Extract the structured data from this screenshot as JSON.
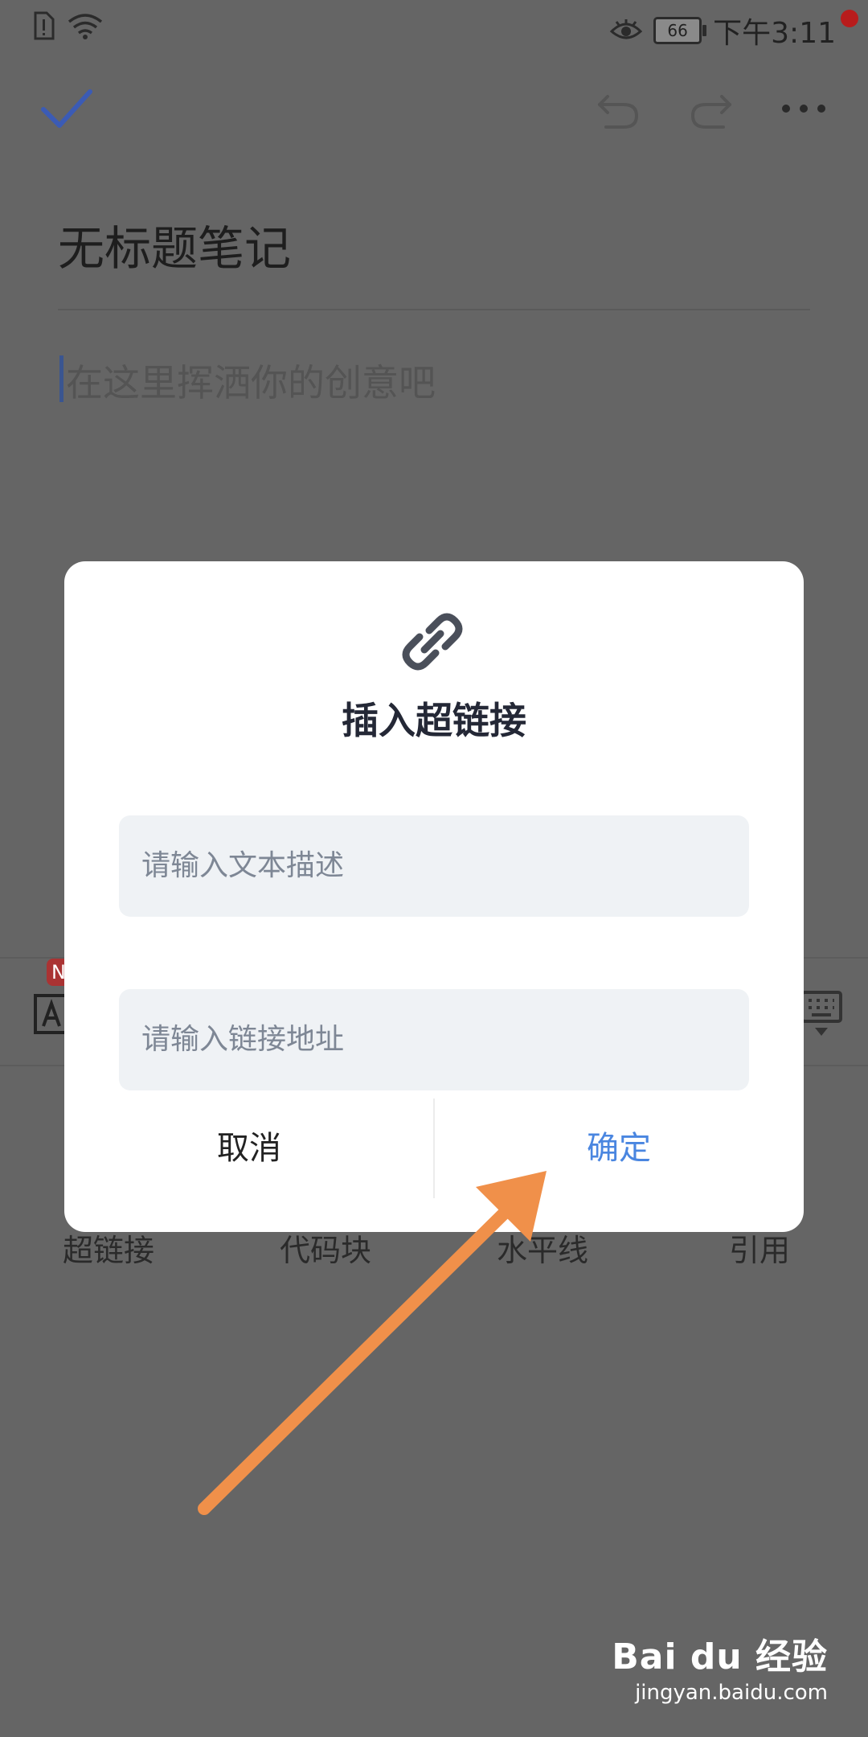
{
  "status_bar": {
    "battery": "66",
    "time": "下午3:11"
  },
  "toolbar": {
    "icons": [
      "check-icon",
      "undo-icon",
      "redo-icon",
      "more-icon"
    ],
    "accent": "#3b5bb5"
  },
  "note": {
    "title": "无标题笔记",
    "placeholder": "在这里挥洒你的创意吧"
  },
  "format_bar": {
    "badge": "N"
  },
  "insert_items": [
    "超链接",
    "代码块",
    "水平线",
    "引用"
  ],
  "dialog": {
    "title": "插入超链接",
    "description_placeholder": "请输入文本描述",
    "url_placeholder": "请输入链接地址",
    "cancel_label": "取消",
    "confirm_label": "确定",
    "confirm_color": "#4a86e0"
  },
  "annotation": {
    "arrow_color": "#f0904a"
  },
  "watermark": {
    "logo": "Bai du 经验",
    "url": "jingyan.baidu.com"
  }
}
